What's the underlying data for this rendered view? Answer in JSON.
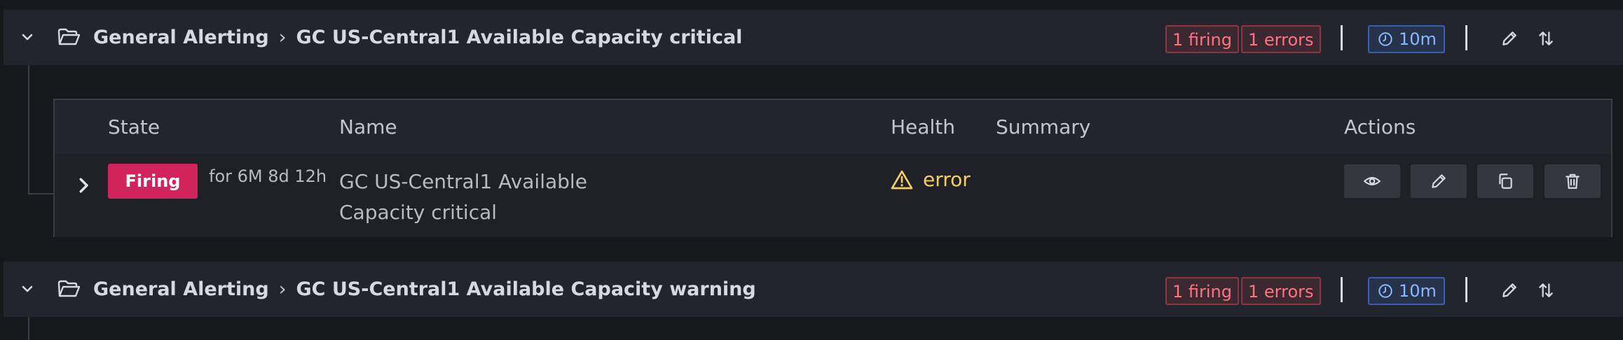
{
  "groups": [
    {
      "namespace": "General Alerting",
      "separator": "›",
      "rule_group": "GC US-Central1 Available Capacity critical",
      "firing_badge": "1 firing",
      "errors_badge": "1 errors",
      "interval": "10m"
    },
    {
      "namespace": "General Alerting",
      "separator": "›",
      "rule_group": "GC US-Central1 Available Capacity warning",
      "firing_badge": "1 firing",
      "errors_badge": "1 errors",
      "interval": "10m"
    }
  ],
  "table": {
    "headers": {
      "state": "State",
      "name": "Name",
      "health": "Health",
      "summary": "Summary",
      "actions": "Actions"
    },
    "rows": [
      {
        "state": "Firing",
        "duration": "for 6M 8d 12h",
        "name_line1": "GC US-Central1 Available",
        "name_line2": "Capacity critical",
        "health": "error",
        "summary": ""
      }
    ]
  },
  "icons": {
    "collapse": "chevron-down-icon",
    "folder": "folder-open-icon",
    "clock": "clock-icon",
    "edit": "pencil-icon",
    "reorder": "sort-arrows-icon",
    "expand_row": "chevron-right-icon",
    "warning": "warning-triangle-icon",
    "view": "eye-icon",
    "duplicate": "copy-icon",
    "delete": "trash-icon"
  },
  "colors": {
    "firing": "#d1245c",
    "error_text": "#f5d061",
    "badge_error": "#ff7383",
    "interval": "#8ab8ff"
  }
}
